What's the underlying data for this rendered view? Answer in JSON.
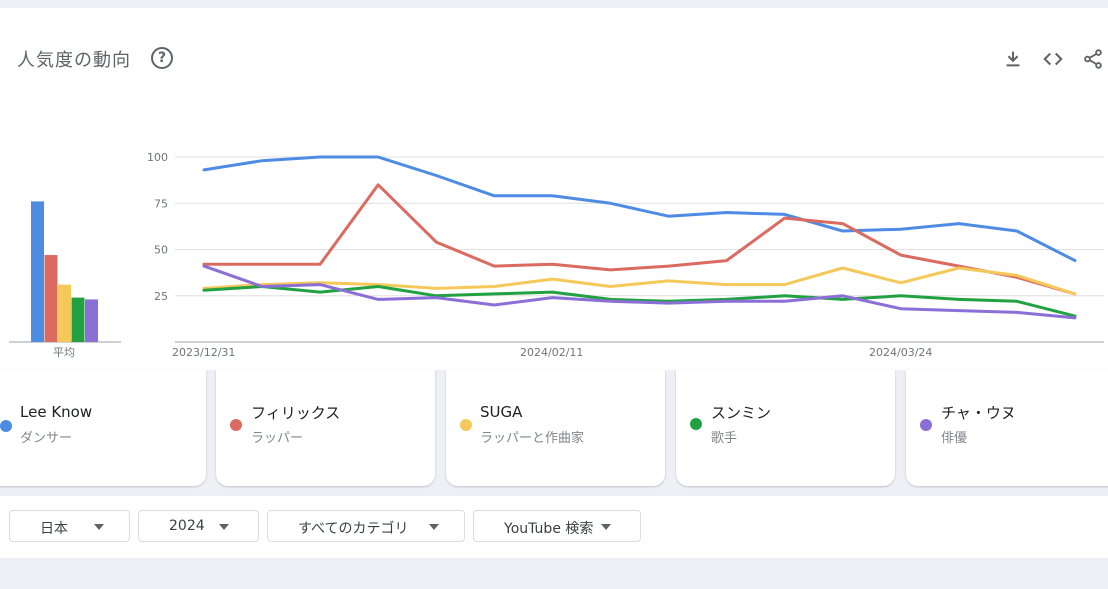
{
  "header": {
    "title": "人気度の動向"
  },
  "chart_data": {
    "type": "line",
    "x": [
      "2023/12/31",
      "2024/01/07",
      "2024/01/14",
      "2024/01/21",
      "2024/01/28",
      "2024/02/04",
      "2024/02/11",
      "2024/02/18",
      "2024/02/25",
      "2024/03/03",
      "2024/03/10",
      "2024/03/17",
      "2024/03/24",
      "2024/03/31",
      "2024/04/07",
      "2024/04/14"
    ],
    "x_tick_labels": [
      "2023/12/31",
      "2024/02/11",
      "2024/03/24"
    ],
    "y_ticks": [
      100,
      75,
      50,
      25
    ],
    "ylim": [
      0,
      100
    ],
    "grid": true,
    "series": [
      {
        "name": "Lee Know",
        "color": "#4e8ce4",
        "values": [
          93,
          98,
          100,
          100,
          90,
          79,
          79,
          75,
          68,
          70,
          69,
          60,
          61,
          64,
          60,
          44
        ]
      },
      {
        "name": "フィリックス",
        "color": "#db6a60",
        "values": [
          42,
          42,
          42,
          85,
          54,
          41,
          42,
          39,
          41,
          44,
          67,
          64,
          47,
          41,
          35,
          26
        ]
      },
      {
        "name": "SUGA",
        "color": "#f4c95a",
        "values": [
          29,
          31,
          32,
          31,
          29,
          30,
          34,
          30,
          33,
          31,
          31,
          40,
          32,
          40,
          36,
          26
        ]
      },
      {
        "name": "スンミン",
        "color": "#21a142",
        "values": [
          28,
          30,
          27,
          30,
          25,
          26,
          27,
          23,
          22,
          23,
          25,
          23,
          25,
          23,
          22,
          14
        ]
      },
      {
        "name": "チャ・ウヌ",
        "color": "#8b6fd6",
        "values": [
          41,
          30,
          31,
          23,
          24,
          20,
          24,
          22,
          21,
          22,
          22,
          25,
          18,
          17,
          16,
          13
        ]
      }
    ],
    "average": {
      "label": "平均",
      "values": [
        76,
        47,
        31,
        24,
        23
      ]
    }
  },
  "legend": [
    {
      "name": "Lee Know",
      "subtitle": "ダンサー",
      "color": "#4e8ce4"
    },
    {
      "name": "フィリックス",
      "subtitle": "ラッパー",
      "color": "#db6a60"
    },
    {
      "name": "SUGA",
      "subtitle": "ラッパーと作曲家",
      "color": "#f4c95a"
    },
    {
      "name": "スンミン",
      "subtitle": "歌手",
      "color": "#21a142"
    },
    {
      "name": "チャ・ウヌ",
      "subtitle": "俳優",
      "color": "#8b6fd6"
    }
  ],
  "filters": {
    "region": "日本",
    "period": "2024",
    "category": "すべてのカテゴリ",
    "search_type": "YouTube 検索"
  },
  "icons": [
    "help-icon",
    "download-icon",
    "embed-code-icon",
    "share-icon",
    "dropdown-caret-icon"
  ]
}
